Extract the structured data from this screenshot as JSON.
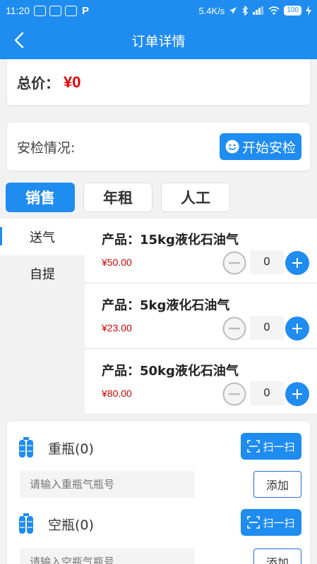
{
  "status_bar": {
    "time": "11:20",
    "apps": [
      "",
      "",
      ""
    ],
    "p_icon": "P",
    "speed": "5.4K/s",
    "battery": "100"
  },
  "nav": {
    "title": "订单详情",
    "back_icon": "chevron-left-icon"
  },
  "summary": {
    "total_label": "总价：",
    "total_value": "¥0"
  },
  "inspection": {
    "label": "安检情况:",
    "button_label": "开始安检",
    "button_icon": "smile-icon"
  },
  "tabs": [
    {
      "label": "销售",
      "active": true
    },
    {
      "label": "年租",
      "active": false
    },
    {
      "label": "人工",
      "active": false
    }
  ],
  "sidebar": [
    {
      "label": "送气",
      "active": true
    },
    {
      "label": "自提",
      "active": false
    }
  ],
  "products": [
    {
      "name": "产品：15kg液化石油气",
      "price": "¥50.00",
      "qty": "0"
    },
    {
      "name": "产品：5kg液化石油气",
      "price": "¥23.00",
      "qty": "0"
    },
    {
      "name": "产品：50kg液化石油气",
      "price": "¥80.00",
      "qty": "0"
    }
  ],
  "bottles": {
    "full": {
      "label": "重瓶(0)",
      "scan_label": "扫一扫",
      "placeholder": "请输入重瓶气瓶号",
      "add_label": "添加"
    },
    "empty": {
      "label": "空瓶(0)",
      "scan_label": "扫一扫",
      "placeholder": "请输入空瓶气瓶号",
      "add_label": "添加"
    }
  },
  "colors": {
    "primary": "#1f8cf0",
    "price": "#d10000",
    "total": "#e60000"
  }
}
